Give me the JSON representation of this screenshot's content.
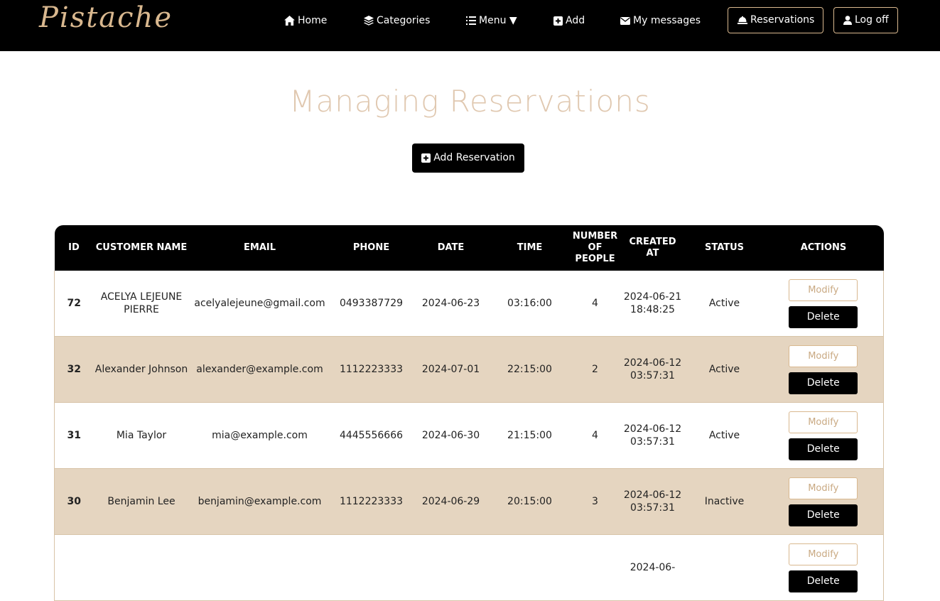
{
  "nav": {
    "logo": "Pistache",
    "home": "Home",
    "categories": "Categories",
    "menu": "Menu ▼",
    "add": "Add",
    "messages": "My messages",
    "reservations": "Reservations",
    "logoff": "Log off"
  },
  "page": {
    "title": "Managing Reservations",
    "add_button": "Add Reservation"
  },
  "table": {
    "headers": [
      "ID",
      "CUSTOMER NAME",
      "EMAIL",
      "PHONE",
      "DATE",
      "TIME",
      "NUMBER OF PEOPLE",
      "CREATED AT",
      "STATUS",
      "ACTIONS"
    ],
    "modify_label": "Modify",
    "delete_label": "Delete",
    "rows": [
      {
        "id": "72",
        "name": "ACELYA LEJEUNE PIERRE",
        "email": "acelyalejeune@gmail.com",
        "phone": "0493387729",
        "date": "2024-06-23",
        "time": "03:16:00",
        "people": "4",
        "created": "2024-06-21 18:48:25",
        "status": "Active"
      },
      {
        "id": "32",
        "name": "Alexander Johnson",
        "email": "alexander@example.com",
        "phone": "1112223333",
        "date": "2024-07-01",
        "time": "22:15:00",
        "people": "2",
        "created": "2024-06-12 03:57:31",
        "status": "Active"
      },
      {
        "id": "31",
        "name": "Mia Taylor",
        "email": "mia@example.com",
        "phone": "4445556666",
        "date": "2024-06-30",
        "time": "21:15:00",
        "people": "4",
        "created": "2024-06-12 03:57:31",
        "status": "Active"
      },
      {
        "id": "30",
        "name": "Benjamin Lee",
        "email": "benjamin@example.com",
        "phone": "1112223333",
        "date": "2024-06-29",
        "time": "20:15:00",
        "people": "3",
        "created": "2024-06-12 03:57:31",
        "status": "Inactive"
      },
      {
        "id": "",
        "name": "",
        "email": "",
        "phone": "",
        "date": "",
        "time": "",
        "people": "",
        "created": "2024-06-",
        "status": ""
      }
    ]
  },
  "colors": {
    "accent": "#d9b88f",
    "row_alt": "#e5d5c0",
    "title": "#e0c8b0"
  }
}
